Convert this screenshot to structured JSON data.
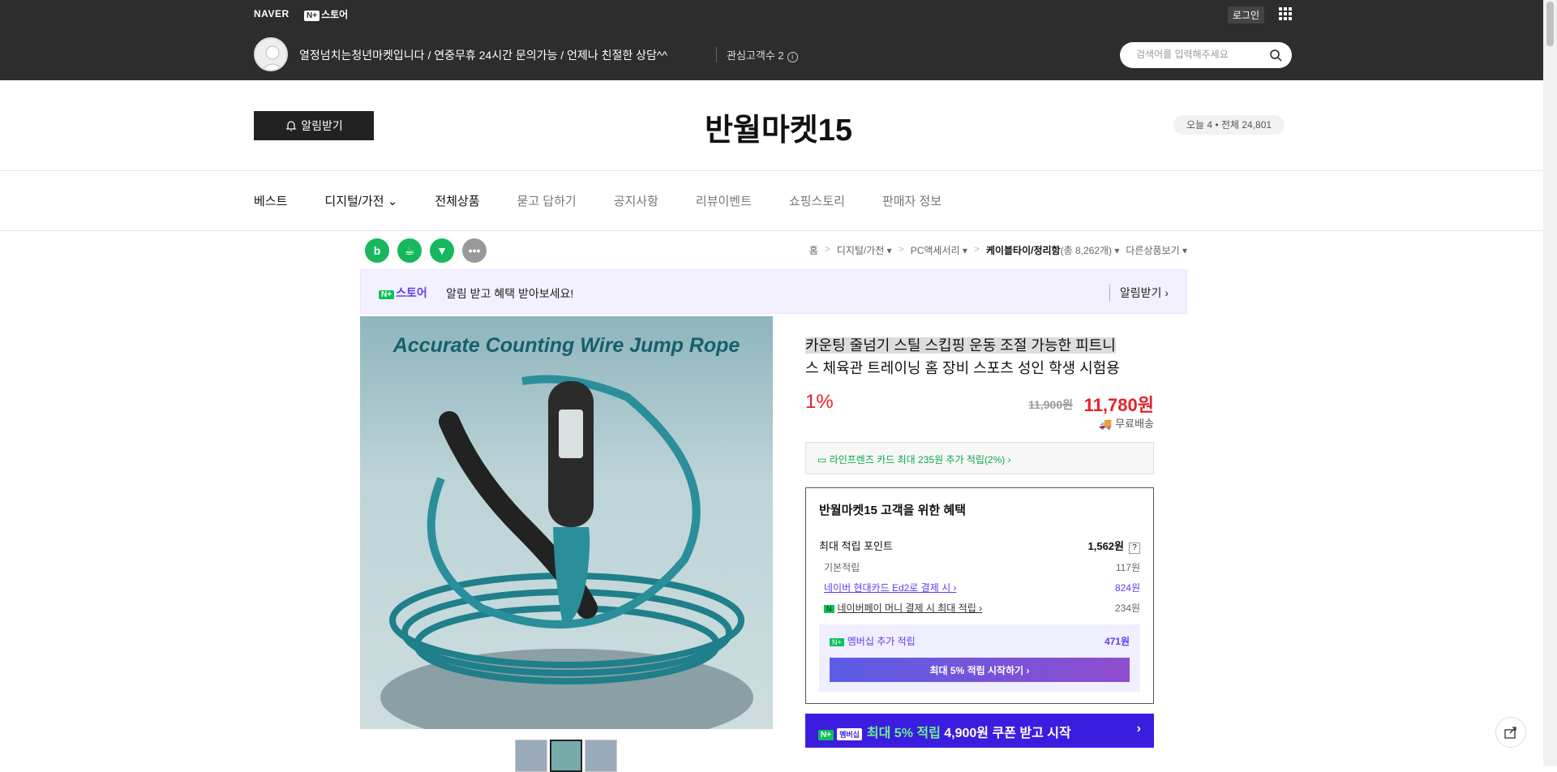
{
  "topbar": {
    "naver": "NAVER",
    "nstore_box": "N+",
    "nstore": "스토어",
    "login": "로그인",
    "store_intro": "열정넘치는청년마켓입니다 / 연중무휴 24시간 문의가능 / 언제나 친절한 상담^^",
    "interest": "관심고객수 2",
    "search_placeholder": "검색어를 입력해주세요"
  },
  "header": {
    "alarm_button": "알림받기",
    "store_name": "반월마켓15",
    "visitors": "오늘 4 • 전체 24,801"
  },
  "nav": {
    "items": [
      "베스트",
      "디지털/가전",
      "전체상품",
      "묻고 답하기",
      "공지사항",
      "리뷰이벤트",
      "쇼핑스토리",
      "판매자 정보"
    ]
  },
  "breadcrumb": {
    "home": "홈",
    "c1": "디지털/가전 ▾",
    "c2": "PC액세서리 ▾",
    "c3": "케이블타이/정리함",
    "count": "(총 8,262개) ▾",
    "other": "다른상품보기 ▾"
  },
  "banner": {
    "logo_box": "N+",
    "logo": "스토어",
    "text": "알림 받고 혜택 받아보세요!",
    "right": "알림받기 ›"
  },
  "product": {
    "image_title": "Accurate Counting Wire Jump Rope",
    "title_highlight": "카운팅 줄넘기 스틸 스킵핑 운동 조절 가능한 피트니",
    "title_rest": "스 체육관 트레이닝 홈 장비 스포츠 성인 학생 시험용",
    "discount": "1%",
    "original_price": "11,900원",
    "price": "11,780원",
    "shipping": "무료배송",
    "card_benefit": "라인프렌즈 카드 최대 235원 추가 적립(2%) ›"
  },
  "benefit": {
    "title": "반월마켓15 고객을 위한 혜택",
    "max_label": "최대 적립 포인트",
    "max_value": "1,562원",
    "q": "?",
    "rows": [
      {
        "label": "기본적립",
        "value": "117원"
      },
      {
        "label": "네이버 현대카드 Ed2로 결제 시 ›",
        "value": "824원"
      },
      {
        "label": "네이버페이 머니 결제 시 최대 적립 ›",
        "value": "234원"
      }
    ],
    "member_label": "멤버십 추가 적립",
    "member_value": "471원",
    "member_button": "최대 5% 적립 시작하기 ›"
  },
  "promo": {
    "nb": "N+",
    "mb": "멤버십",
    "hi": "최대 5% 적립",
    "text": "4,900원 쿠폰 받고 시작",
    "chev": "›"
  }
}
